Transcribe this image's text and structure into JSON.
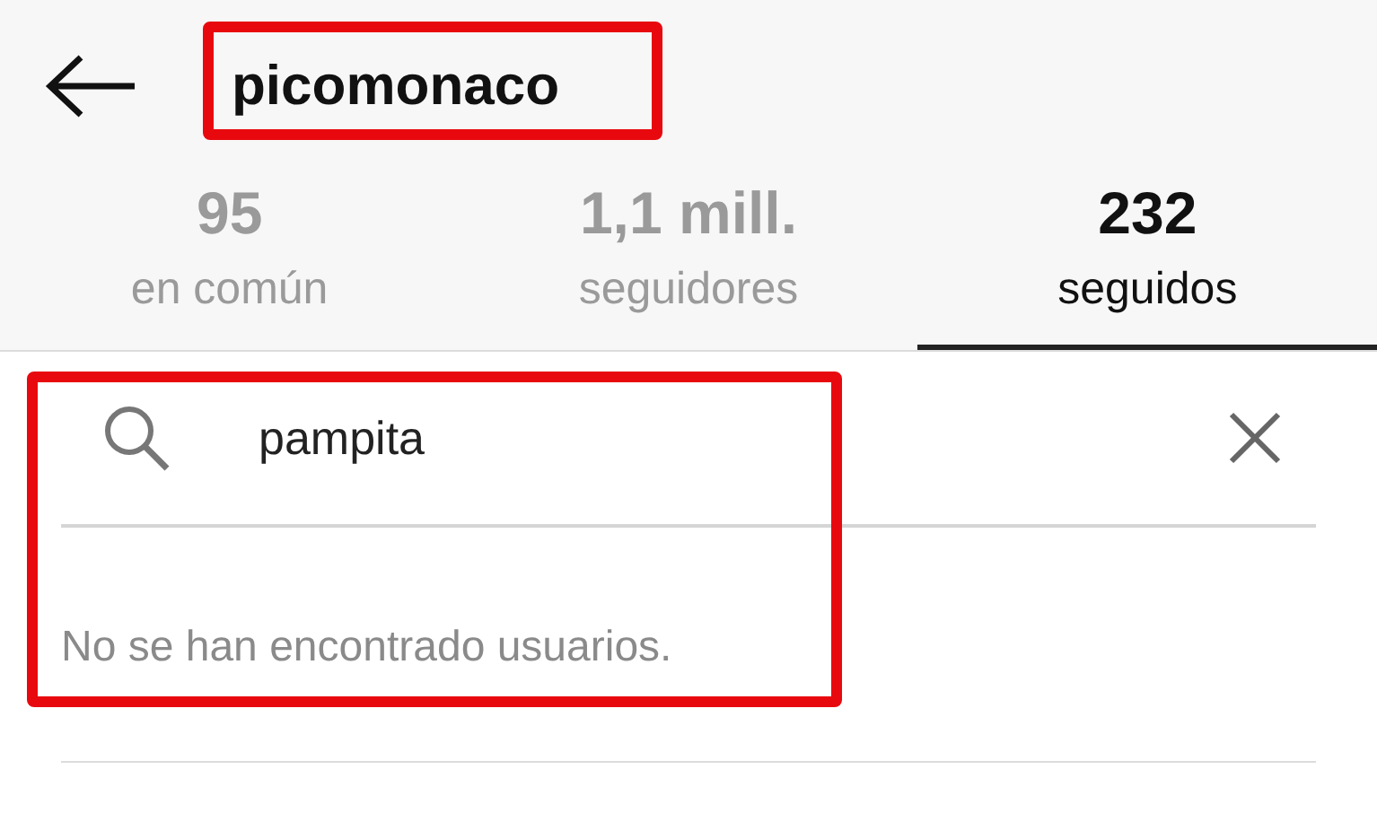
{
  "header": {
    "username": "picomonaco",
    "highlighted": true
  },
  "tabs": [
    {
      "count": "95",
      "label": "en común",
      "selected": false
    },
    {
      "count": "1,1 mill.",
      "label": "seguidores",
      "selected": false
    },
    {
      "count": "232",
      "label": "seguidos",
      "selected": true
    }
  ],
  "search": {
    "value": "pampita",
    "message": "No se han encontrado usuarios.",
    "highlighted": true
  }
}
